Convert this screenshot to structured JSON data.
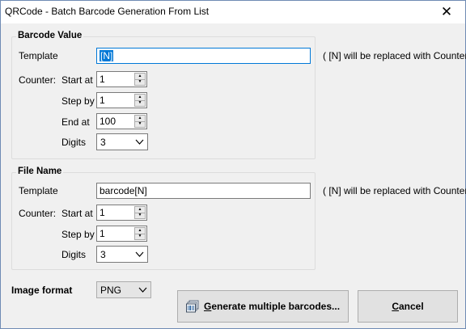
{
  "window": {
    "title": "QRCode - Batch Barcode Generation From List",
    "close_glyph": "✕"
  },
  "barcode_value": {
    "group_title": "Barcode Value",
    "template_label": "Template",
    "template_value": "[N]",
    "template_hint": "( [N] will be replaced with Counter )",
    "counter_label": "Counter:",
    "start_label": "Start at",
    "start_value": "1",
    "step_label": "Step by",
    "step_value": "1",
    "end_label": "End at",
    "end_value": "100",
    "digits_label": "Digits",
    "digits_value": "3"
  },
  "file_name": {
    "group_title": "File Name",
    "template_label": "Template",
    "template_value": "barcode[N]",
    "template_hint": "( [N] will be replaced with Counter )",
    "counter_label": "Counter:",
    "start_label": "Start at",
    "start_value": "1",
    "step_label": "Step by",
    "step_value": "1",
    "digits_label": "Digits",
    "digits_value": "3"
  },
  "image_format": {
    "label": "Image format",
    "value": "PNG"
  },
  "buttons": {
    "generate_mnemonic": "G",
    "generate_rest": "enerate multiple barcodes...",
    "generate_icon": "barcode-stack-icon",
    "cancel_mnemonic": "C",
    "cancel_rest": "ancel"
  }
}
